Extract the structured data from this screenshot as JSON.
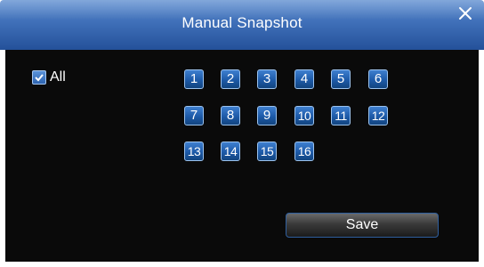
{
  "dialog": {
    "title": "Manual Snapshot",
    "close_icon": "close-icon"
  },
  "select_all": {
    "label": "All",
    "checked": true
  },
  "channels": [
    "1",
    "2",
    "3",
    "4",
    "5",
    "6",
    "7",
    "8",
    "9",
    "10",
    "11",
    "12",
    "13",
    "14",
    "15",
    "16"
  ],
  "actions": {
    "save_label": "Save"
  },
  "colors": {
    "title_bar": "#3f6fb8",
    "panel_bg": "#0a0a0a",
    "channel_button": "#1d5aa8",
    "text": "#ffffff"
  }
}
